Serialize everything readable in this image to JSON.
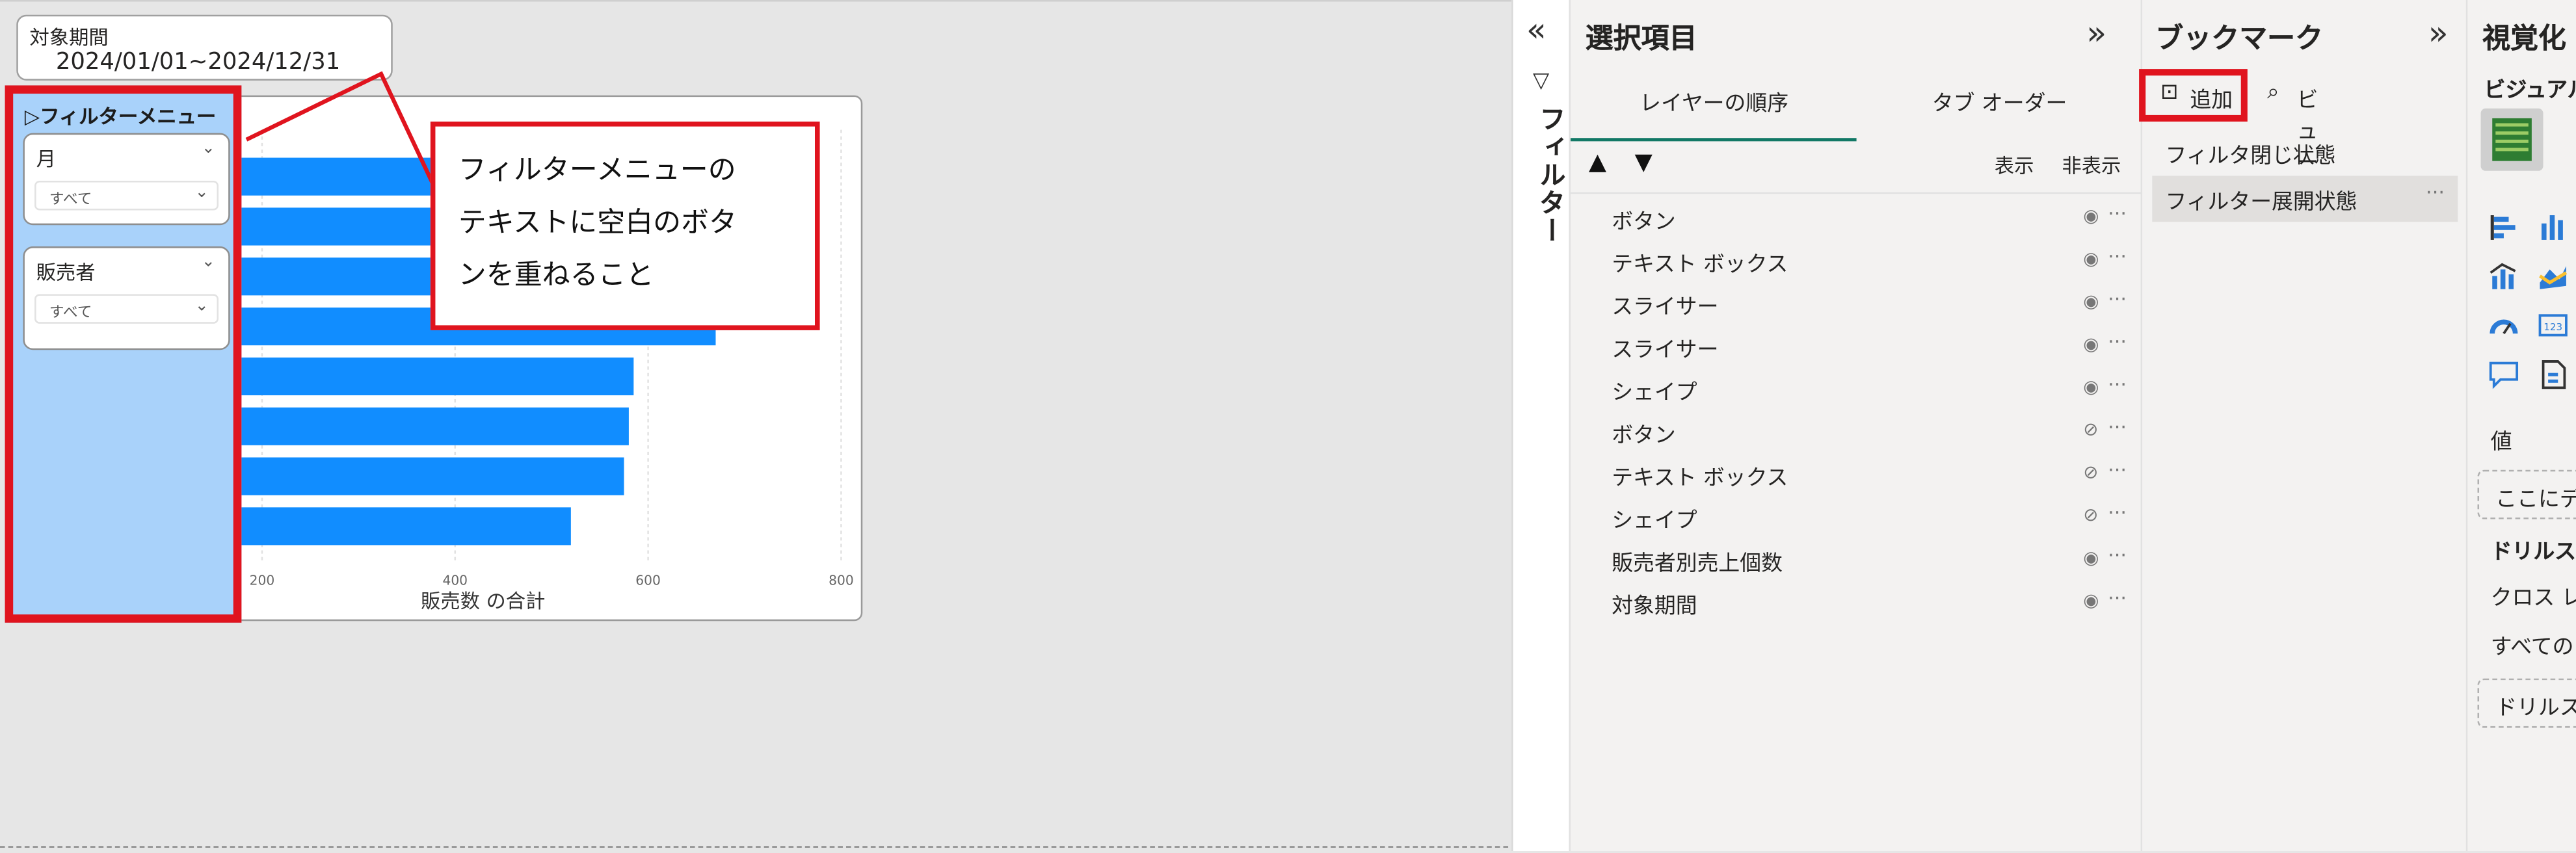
{
  "canvas": {
    "period_card": {
      "title": "対象期間",
      "value": "2024/01/01~2024/12/31"
    },
    "filter_menu": {
      "title": "▷フィルターメニュー",
      "slicers": [
        {
          "title": "月",
          "value": "すべて"
        },
        {
          "title": "販売者",
          "value": "すべて"
        }
      ]
    },
    "callout_lines": [
      "フィルターメニューの",
      "テキストに空白のボタ",
      "ンを重ねること"
    ]
  },
  "chart_data": {
    "type": "bar",
    "orientation": "horizontal",
    "values": [
      560,
      540,
      720,
      670,
      585,
      580,
      575,
      520
    ],
    "xlabel": "販売数 の合計",
    "xticks": [
      "200",
      "400",
      "600",
      "800"
    ],
    "xlim": [
      0,
      800
    ],
    "grid": true,
    "bar_color": "#118DFF"
  },
  "filters_strip": {
    "collapse_icon": "double-chevron-left",
    "filter_icon": "funnel",
    "label": "フィルター"
  },
  "selection_pane": {
    "title": "選択項目",
    "collapse_icon": "double-chevron-right",
    "tabs": [
      "レイヤーの順序",
      "タブ オーダー"
    ],
    "active_tab": 0,
    "show_label": "表示",
    "hide_label": "非表示",
    "layers": [
      {
        "label": "ボタン",
        "visible": true
      },
      {
        "label": "テキスト ボックス",
        "visible": true
      },
      {
        "label": "スライサー",
        "visible": true
      },
      {
        "label": "スライサー",
        "visible": true
      },
      {
        "label": "シェイプ",
        "visible": true
      },
      {
        "label": "ボタン",
        "visible": false
      },
      {
        "label": "テキスト ボックス",
        "visible": false
      },
      {
        "label": "シェイプ",
        "visible": false
      },
      {
        "label": "販売者別売上個数",
        "visible": true
      },
      {
        "label": "対象期間",
        "visible": true
      }
    ],
    "more_glyph": "···"
  },
  "bookmark_pane": {
    "title": "ブックマーク",
    "add_label": "追加",
    "view_label": "ビュー",
    "items": [
      "フィルタ閉じ状態",
      "フィルター展開状態"
    ],
    "more_glyph": "···"
  },
  "viz_pane": {
    "title": "視覚化",
    "subtitle": "ビジュアル",
    "values_label": "値",
    "field_placeholder": "ここにデ",
    "drill_title": "ドリルス",
    "cross_label": "クロス レ",
    "all_label": "すべての",
    "drill_placeholder": "ドリルス"
  },
  "colors": {
    "accent_red": "#E0141E",
    "bar_blue": "#118DFF",
    "filter_panel_bg": "#A9D2FA",
    "tab_underline": "#117865"
  }
}
